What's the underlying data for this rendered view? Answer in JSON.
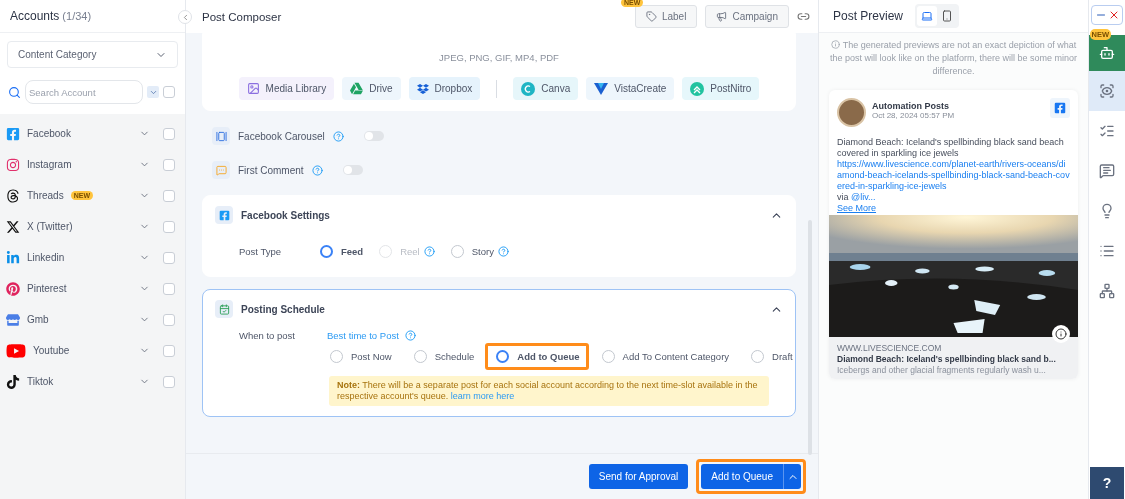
{
  "sidebar": {
    "title": "Accounts",
    "count": "(1/34)",
    "category_select": "Content Category",
    "search": {
      "placeholder": "Search Account"
    },
    "select_all_checked": false,
    "accounts": [
      {
        "name": "Facebook",
        "kind": "facebook",
        "checked": false
      },
      {
        "name": "Instagram",
        "kind": "instagram",
        "checked": false
      },
      {
        "name": "Threads",
        "kind": "threads",
        "badge": "NEW",
        "checked": false
      },
      {
        "name": "X (Twitter)",
        "kind": "x",
        "checked": false
      },
      {
        "name": "Linkedin",
        "kind": "linkedin",
        "checked": false
      },
      {
        "name": "Pinterest",
        "kind": "pinterest",
        "checked": false
      },
      {
        "name": "Gmb",
        "kind": "gmb",
        "checked": false
      },
      {
        "name": "Youtube",
        "kind": "youtube",
        "checked": false
      },
      {
        "name": "Tiktok",
        "kind": "tiktok",
        "checked": false
      }
    ]
  },
  "composer": {
    "title": "Post Composer",
    "new_badge": "NEW",
    "label_button": "Label",
    "campaign_button": "Campaign",
    "file_types": "JPEG, PNG, GIF, MP4, PDF",
    "media_sources": [
      {
        "label": "Media Library",
        "kind": "library"
      },
      {
        "label": "Drive",
        "kind": "drive"
      },
      {
        "label": "Dropbox",
        "kind": "dropbox"
      }
    ],
    "design_tools": [
      {
        "label": "Canva",
        "kind": "canva"
      },
      {
        "label": "VistaCreate",
        "kind": "vista"
      },
      {
        "label": "PostNitro",
        "kind": "nitro"
      }
    ],
    "toggles": [
      {
        "label": "Facebook Carousel",
        "kind": "carousel",
        "on": false
      },
      {
        "label": "First Comment",
        "kind": "comment",
        "on": false
      }
    ],
    "facebook_settings": {
      "title": "Facebook Settings",
      "expanded": true,
      "post_type_label": "Post Type",
      "options": [
        {
          "label": "Feed",
          "selected": true,
          "disabled": false,
          "help": false
        },
        {
          "label": "Reel",
          "selected": false,
          "disabled": true,
          "help": true
        },
        {
          "label": "Story",
          "selected": false,
          "disabled": false,
          "help": true
        }
      ]
    },
    "posting_schedule": {
      "title": "Posting Schedule",
      "expanded": true,
      "when_label": "When to post",
      "best_time_link": "Best time to Post",
      "options": [
        {
          "label": "Post Now",
          "selected": false,
          "highlighted": false
        },
        {
          "label": "Schedule",
          "selected": false,
          "highlighted": false
        },
        {
          "label": "Add to Queue",
          "selected": true,
          "highlighted": true
        },
        {
          "label": "Add To Content Category",
          "selected": false,
          "highlighted": false
        },
        {
          "label": "Draft",
          "selected": false,
          "highlighted": false
        }
      ],
      "note": {
        "text": "**Note:** There will be a separate post for each social account according to the next time-slot available in the respective account's queue.",
        "link": "learn more here"
      }
    },
    "footer": {
      "secondary_button": "Send for Approval",
      "primary_button": "Add to Queue",
      "primary_highlighted": true
    }
  },
  "preview": {
    "title": "Post Preview",
    "devices": [
      {
        "kind": "desktop",
        "selected": true
      },
      {
        "kind": "mobile",
        "selected": false
      }
    ],
    "notice": "The generated previews are not an exact depiction of what the post will look like on the platform, there will be some minor difference.",
    "post": {
      "author": "Automation Posts",
      "time": "Oct 28, 2024 05:57 PM",
      "text": "Diamond Beach: Iceland's spellbinding black sand beach covered in sparkling ice jewels",
      "url": "https://www.livescience.com/planet-earth/rivers-oceans/diamond-beach-icelands-spellbinding-black-sand-beach-covered-in-sparkling-ice-jewels",
      "via": "via",
      "handle": "@liv...",
      "see_more": "See More",
      "link_domain": "WWW.LIVESCIENCE.COM",
      "link_title": "Diamond Beach: Iceland's spellbinding black sand b...",
      "link_description": "Icebergs and other glacial fragments regularly wash u..."
    }
  },
  "rail": {
    "new_badge": "NEW",
    "items": [
      {
        "kind": "bot",
        "selected": false
      },
      {
        "kind": "eye",
        "selected": true
      },
      {
        "kind": "checklist",
        "selected": false
      },
      {
        "kind": "chat",
        "selected": false
      },
      {
        "kind": "idea",
        "selected": false
      },
      {
        "kind": "list",
        "selected": false
      },
      {
        "kind": "network",
        "selected": false
      }
    ],
    "help": "?"
  }
}
